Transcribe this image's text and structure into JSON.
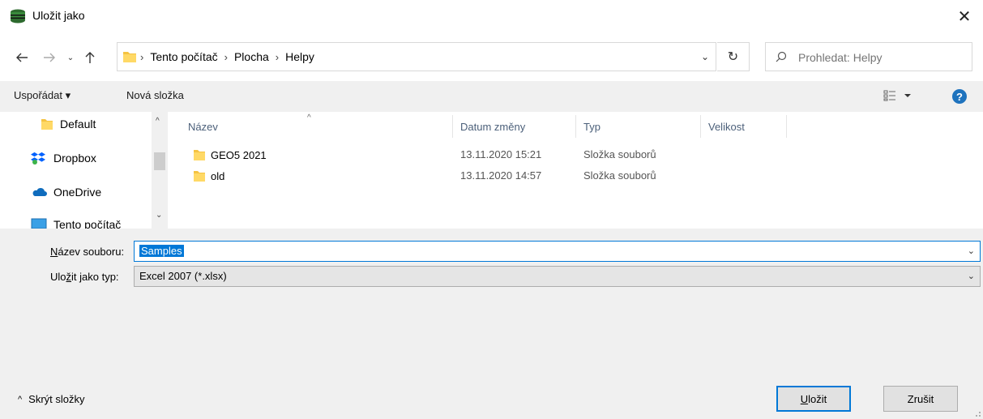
{
  "window": {
    "title": "Uložit jako"
  },
  "address": {
    "crumbs": [
      "Tento počítač",
      "Plocha",
      "Helpy"
    ]
  },
  "search": {
    "placeholder": "Prohledat: Helpy"
  },
  "toolbar": {
    "organize_label": "Uspořádat ▾",
    "new_folder_label": "Nová složka"
  },
  "nav_pane": {
    "items": [
      {
        "label": "Default",
        "icon": "folder-icon"
      },
      {
        "label": "Dropbox",
        "icon": "dropbox-icon"
      },
      {
        "label": "OneDrive",
        "icon": "onedrive-icon"
      },
      {
        "label": "Tento počítač",
        "icon": "computer-icon"
      }
    ]
  },
  "file_list": {
    "columns": [
      "Název",
      "Datum změny",
      "Typ",
      "Velikost"
    ],
    "rows": [
      {
        "name": "GEO5 2021",
        "date": "13.11.2020 15:21",
        "type": "Složka souborů"
      },
      {
        "name": "old",
        "date": "13.11.2020 14:57",
        "type": "Složka souborů"
      }
    ]
  },
  "form": {
    "filename_label_pre": "N",
    "filename_label_rest": "ázev souboru:",
    "filename_value": "Samples",
    "filetype_label_pre": "Ulo",
    "filetype_label_u": "ž",
    "filetype_label_post": "it jako typ:",
    "filetype_value": "Excel 2007 (*.xlsx)"
  },
  "footer": {
    "hide_folders_label": "Skrýt složky",
    "save_u": "U",
    "save_rest": "ložit",
    "cancel_label": "Zrušit"
  },
  "colors": {
    "accent": "#0078d7",
    "folder": "#f5c342",
    "panel": "#f0f0f0"
  }
}
